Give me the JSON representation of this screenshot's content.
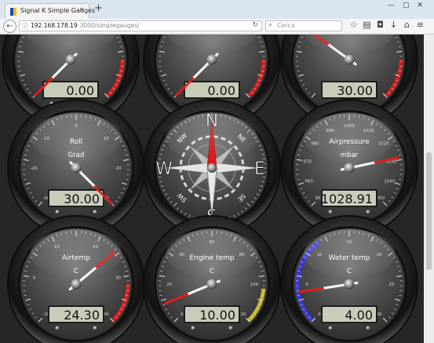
{
  "browser": {
    "tab_title": "Signal K Simple Gauges",
    "close_glyph": "×",
    "new_tab_glyph": "+",
    "window_controls": "—▢✕",
    "back_glyph": "←",
    "info_glyph": "ⓘ",
    "url_host": "192.168.178.19",
    "url_path": ":3000/simplegauges/",
    "reload_glyph": "↻",
    "search_glyph": "⌕",
    "search_placeholder": "Cerca",
    "toolbar_icons": [
      "star-icon",
      "reading-list-icon",
      "pocket-icon",
      "download-icon",
      "home-icon",
      "menu-icon"
    ],
    "toolbar_glyphs": [
      "☆",
      "▤",
      "◘",
      "↓",
      "⌂",
      "≡"
    ]
  },
  "gauges": [
    {
      "id": "g1",
      "label": "",
      "unit": "",
      "value": "0.00",
      "min": 0,
      "max": 100,
      "reading": 0,
      "ticks": [
        "",
        "",
        "",
        "",
        "",
        ""
      ],
      "red_arc": true,
      "blue_arc": false,
      "yellow_arc": false
    },
    {
      "id": "g2",
      "label": "",
      "unit": "",
      "value": "0.00",
      "min": 0,
      "max": 100,
      "reading": 0,
      "ticks": [
        "",
        "",
        "",
        "",
        "",
        ""
      ],
      "red_arc": true,
      "blue_arc": false,
      "yellow_arc": false
    },
    {
      "id": "g3",
      "label": "",
      "unit": "",
      "value": "30.00",
      "min": 0,
      "max": 100,
      "reading": 30,
      "ticks": [
        "",
        "",
        "",
        "",
        "",
        ""
      ],
      "red_arc": true,
      "blue_arc": false,
      "yellow_arc": false
    },
    {
      "id": "roll",
      "label": "Roll",
      "unit": "Grad",
      "value": "30.00",
      "min": -30,
      "max": 30,
      "reading": 30,
      "ticks": [
        "-30",
        "-20",
        "-10",
        "0",
        "10",
        "20",
        "30"
      ],
      "red_arc": false,
      "blue_arc": false,
      "yellow_arc": false
    },
    {
      "id": "compass",
      "label": "",
      "unit": "",
      "value": "",
      "min": 0,
      "max": 360,
      "reading": 0,
      "ticks": [],
      "red_arc": false,
      "blue_arc": false,
      "yellow_arc": false
    },
    {
      "id": "air",
      "label": "Airpressure",
      "unit": "mbar",
      "value": "1028.91",
      "min": 950,
      "max": 1050,
      "reading": 1028.91,
      "ticks": [
        "950",
        "960",
        "970",
        "980",
        "990",
        "1000",
        "1010",
        "1020",
        "1030",
        "1040",
        "1050"
      ],
      "red_arc": false,
      "blue_arc": false,
      "yellow_arc": false
    },
    {
      "id": "airtemp",
      "label": "Airtemp",
      "unit": "C",
      "value": "24.30",
      "min": -10,
      "max": 40,
      "reading": 24.3,
      "ticks": [
        "-10",
        "0",
        "10",
        "20",
        "30",
        "40"
      ],
      "red_arc": true,
      "blue_arc": false,
      "yellow_arc": false
    },
    {
      "id": "engine",
      "label": "Engine temp",
      "unit": "C",
      "value": "10.00",
      "min": 0,
      "max": 120,
      "reading": 10,
      "ticks": [
        "0",
        "20",
        "40",
        "60",
        "80",
        "100",
        "120"
      ],
      "red_arc": false,
      "blue_arc": false,
      "yellow_arc": true
    },
    {
      "id": "water",
      "label": "Water temp",
      "unit": "C",
      "value": "4.00",
      "min": 0,
      "max": 30,
      "reading": 4,
      "ticks": [
        "0",
        "5",
        "10",
        "15",
        "20",
        "25",
        "30"
      ],
      "red_arc": false,
      "blue_arc": true,
      "yellow_arc": false
    }
  ],
  "compass": {
    "heading": 0,
    "cardinals": {
      "n": "N",
      "e": "E",
      "s": "S",
      "w": "W"
    },
    "intercardinals": {
      "ne": "NE",
      "se": "SE",
      "sw": "SW",
      "nw": "NW"
    }
  },
  "colors": {
    "needle": "#e21b1b",
    "lcd_bg": "#c7cdb9",
    "red_arc": "#d42020",
    "blue_arc": "#3a3ad8",
    "yellow_arc": "#c8b92a"
  }
}
